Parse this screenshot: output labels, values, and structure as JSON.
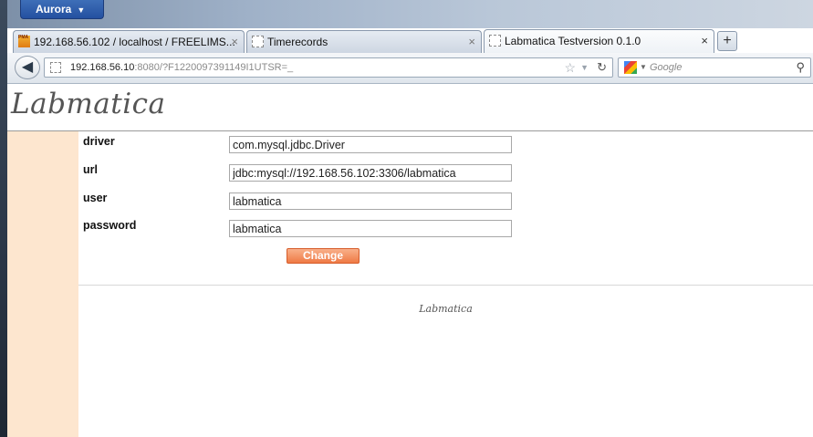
{
  "browser": {
    "app_button": "Aurora",
    "tabs": [
      {
        "label": "192.168.56.102 / localhost / FREELIMS...",
        "favicon": "phpmyadmin-icon",
        "active": false
      },
      {
        "label": "Timerecords",
        "favicon": "blank-page-icon",
        "active": false
      },
      {
        "label": "Labmatica Testversion 0.1.0",
        "favicon": "blank-page-icon",
        "active": true
      }
    ],
    "new_tab": "+",
    "close_glyph": "×",
    "url_host": "192.168.56.10",
    "url_rest": ":8080/?F1220097391149I1UTSR=_",
    "search_placeholder": "Google"
  },
  "page": {
    "logo": "Labmatica",
    "fields": [
      {
        "label": "driver",
        "value": "com.mysql.jdbc.Driver"
      },
      {
        "label": "url",
        "value": "jdbc:mysql://192.168.56.102:3306/labmatica"
      },
      {
        "label": "user",
        "value": "labmatica"
      },
      {
        "label": "password",
        "value": "labmatica"
      }
    ],
    "submit_label": "Change",
    "footer": "Labmatica"
  },
  "colors": {
    "sidebar": "#fde6cf",
    "button": "#ef7a45",
    "app_button": "#2f5fae"
  }
}
